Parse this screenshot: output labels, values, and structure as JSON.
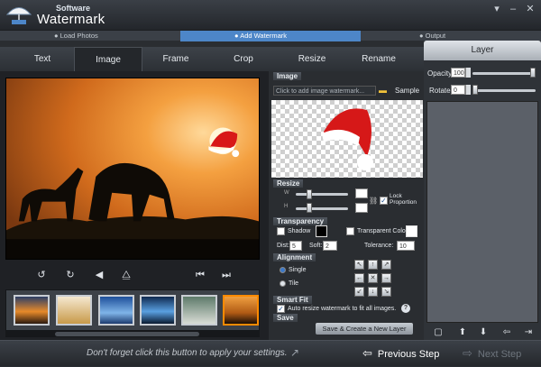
{
  "app": {
    "brand_top": "Software",
    "brand_main": "Watermark"
  },
  "steps": [
    "Load Photos",
    "Add Watermark",
    "Output"
  ],
  "tabs": [
    "Text",
    "Image",
    "Frame",
    "Crop",
    "Resize",
    "Rename"
  ],
  "image_section": {
    "title": "Image",
    "placeholder": "Click to add image watermark...",
    "sample_label": "Sample"
  },
  "resize": {
    "title": "Resize",
    "w_label": "W",
    "h_label": "H",
    "lock_label": "Lock Proportion"
  },
  "transparency": {
    "title": "Transparency",
    "shadow_label": "Shadow",
    "transparent_color_label": "Transparent Color",
    "dist_label": "Dist:",
    "dist_value": "5",
    "soft_label": "Soft:",
    "soft_value": "2",
    "tolerance_label": "Tolerance:",
    "tolerance_value": "10"
  },
  "alignment": {
    "title": "Alignment",
    "single_label": "Single",
    "tile_label": "Tile"
  },
  "smart_fit": {
    "title": "Smart Fit",
    "auto_label": "Auto resize watermark to fit all images."
  },
  "save": {
    "title": "Save",
    "button": "Save & Create a New Layer"
  },
  "layer": {
    "title": "Layer",
    "opacity_label": "Opacity",
    "opacity_value": "100",
    "rotate_label": "Rotate",
    "rotate_value": "0"
  },
  "bottom": {
    "hint": "Don't forget click this button to apply your settings.",
    "prev": "Previous Step",
    "next": "Next Step"
  },
  "colors": {
    "accent": "#4d86c8",
    "highlight": "#ff8a00"
  }
}
